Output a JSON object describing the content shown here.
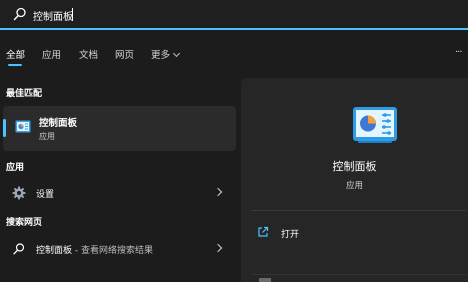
{
  "search": {
    "query": "控制面板"
  },
  "tabs": [
    {
      "label": "全部"
    },
    {
      "label": "应用"
    },
    {
      "label": "文档"
    },
    {
      "label": "网页"
    },
    {
      "label": "更多"
    }
  ],
  "overflow_label": "···",
  "sections": {
    "best_match": "最佳匹配",
    "apps": "应用",
    "web": "搜索网页"
  },
  "best_match": {
    "name": "控制面板",
    "type": "应用"
  },
  "apps": [
    {
      "label": "设置",
      "icon": "gear-icon"
    }
  ],
  "web": [
    {
      "label": "控制面板",
      "suffix": " - 查看网络搜索结果",
      "icon": "search-icon"
    }
  ],
  "detail": {
    "title": "控制面板",
    "subtitle": "应用",
    "actions": [
      {
        "label": "打开",
        "icon": "open-icon"
      }
    ]
  },
  "colors": {
    "accent": "#4cc2ff",
    "background": "#1c1c1c",
    "panel": "#262626"
  }
}
